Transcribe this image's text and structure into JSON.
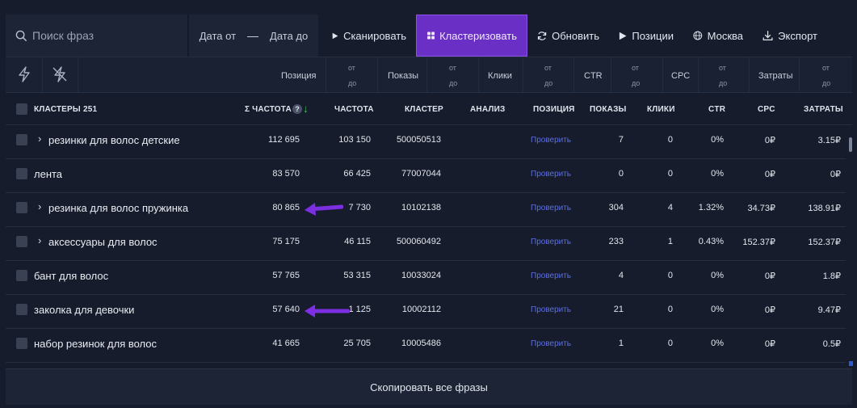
{
  "toolbar": {
    "search_placeholder": "Поиск фраз",
    "date_from": "Дата от",
    "date_dash": "—",
    "date_to": "Дата до",
    "buttons": [
      {
        "label": "Сканировать",
        "icon": "play-icon"
      },
      {
        "label": "Кластеризовать",
        "icon": "grid-icon"
      },
      {
        "label": "Обновить",
        "icon": "refresh-icon"
      },
      {
        "label": "Позиции",
        "icon": "play-icon"
      },
      {
        "label": "Москва",
        "icon": "globe-icon"
      },
      {
        "label": "Экспорт",
        "icon": "download-icon"
      }
    ]
  },
  "filters": {
    "from": "от",
    "to": "до",
    "fields": [
      "Позиция",
      "Показы",
      "Клики",
      "CTR",
      "CPC",
      "Затраты"
    ]
  },
  "table": {
    "headers": {
      "clusters": "КЛАСТЕРЫ",
      "clusters_count": "251",
      "sum_freq": "Σ ЧАСТОТА",
      "freq": "ЧАСТОТА",
      "cluster": "КЛАСТЕР",
      "analysis": "АНАЛИЗ",
      "position": "ПОЗИЦИЯ",
      "shows": "ПОКАЗЫ",
      "clicks": "КЛИКИ",
      "ctr": "CTR",
      "cpc": "CPC",
      "costs": "ЗАТРАТЫ"
    },
    "help_icon": "?",
    "sort_icon": "↓",
    "rows": [
      {
        "expand": "›",
        "phrase": "резинки для волос детские",
        "sum_freq": "112 695",
        "freq": "103 150",
        "cluster": "500050513",
        "position": "Проверить",
        "shows": "7",
        "clicks": "0",
        "ctr": "0%",
        "cpc": "0₽",
        "costs": "3.15₽"
      },
      {
        "expand": "",
        "phrase": "лента",
        "sum_freq": "83 570",
        "freq": "66 425",
        "cluster": "77007044",
        "position": "Проверить",
        "shows": "0",
        "clicks": "0",
        "ctr": "0%",
        "cpc": "0₽",
        "costs": "0₽"
      },
      {
        "expand": "›",
        "phrase": "резинка для волос пружинка",
        "sum_freq": "80 865",
        "freq": "7 730",
        "cluster": "10102138",
        "position": "Проверить",
        "shows": "304",
        "clicks": "4",
        "ctr": "1.32%",
        "cpc": "34.73₽",
        "costs": "138.91₽"
      },
      {
        "expand": "›",
        "phrase": "аксессуары для волос",
        "sum_freq": "75 175",
        "freq": "46 115",
        "cluster": "500060492",
        "position": "Проверить",
        "shows": "233",
        "clicks": "1",
        "ctr": "0.43%",
        "cpc": "152.37₽",
        "costs": "152.37₽"
      },
      {
        "expand": "",
        "phrase": "бант для волос",
        "sum_freq": "57 765",
        "freq": "53 315",
        "cluster": "10033024",
        "position": "Проверить",
        "shows": "4",
        "clicks": "0",
        "ctr": "0%",
        "cpc": "0₽",
        "costs": "1.8₽"
      },
      {
        "expand": "",
        "phrase": "заколка для девочки",
        "sum_freq": "57 640",
        "freq": "1 125",
        "cluster": "10002112",
        "position": "Проверить",
        "shows": "21",
        "clicks": "0",
        "ctr": "0%",
        "cpc": "0₽",
        "costs": "9.47₽"
      },
      {
        "expand": "",
        "phrase": "набор резинок для волос",
        "sum_freq": "41 665",
        "freq": "25 705",
        "cluster": "10005486",
        "position": "Проверить",
        "shows": "1",
        "clicks": "0",
        "ctr": "0%",
        "cpc": "0₽",
        "costs": "0.5₽"
      }
    ]
  },
  "footer": {
    "copy_label": "Скопировать все фразы"
  },
  "colors": {
    "accent": "#6a2fc5",
    "link": "#5b6ee0",
    "annotation_arrow": "#7b2fe0",
    "sort_arrow": "#3fbf5a"
  }
}
